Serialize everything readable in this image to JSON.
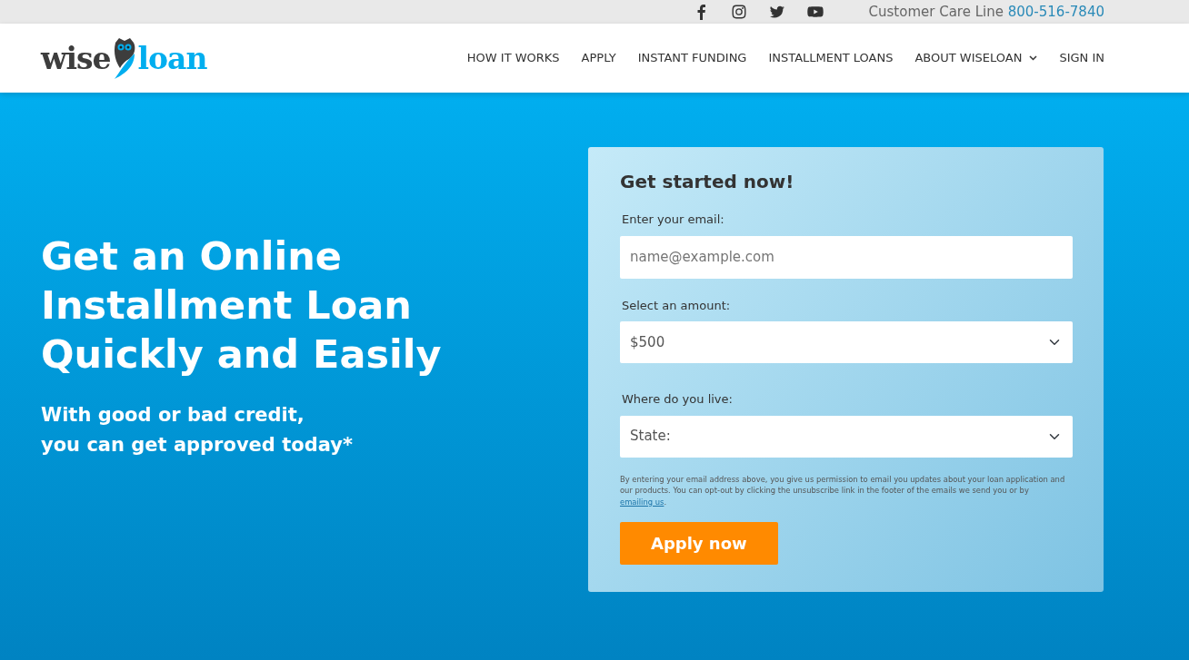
{
  "topbar": {
    "social": [
      {
        "kind": "facebook"
      },
      {
        "kind": "instagram"
      },
      {
        "kind": "twitter"
      },
      {
        "kind": "youtube"
      }
    ],
    "care_label": "Customer Care Line",
    "phone": "800-516-7840"
  },
  "logo": {
    "part_1": "wise",
    "part_2": "loan"
  },
  "nav": [
    {
      "label": "HOW IT WORKS",
      "dropdown": false
    },
    {
      "label": "APPLY",
      "dropdown": false
    },
    {
      "label": "INSTANT FUNDING",
      "dropdown": false
    },
    {
      "label": "INSTALLMENT LOANS",
      "dropdown": false
    },
    {
      "label": "ABOUT WISELOAN",
      "dropdown": true
    },
    {
      "label": "SIGN IN",
      "dropdown": false
    }
  ],
  "hero": {
    "headline": [
      "Get an Online",
      "Installment Loan",
      "Quickly and Easily"
    ],
    "subline": [
      "With good or bad credit,",
      "you can get approved today*"
    ]
  },
  "form": {
    "title": "Get started now!",
    "fields": [
      {
        "kind": "input",
        "label": "Enter your email:",
        "placeholder": "name@example.com"
      },
      {
        "kind": "select",
        "label": "Select an amount:",
        "value": "$500"
      },
      {
        "kind": "select",
        "label": "Where do you live:",
        "value": "State:"
      }
    ],
    "disclaimer": {
      "before": "By entering your email address above, you give us permission to email you updates about your loan application and our products. You can opt-out by clicking the unsubscribe link in the footer of the emails we send you or by ",
      "link": "emailing us",
      "after": "."
    },
    "button": "Apply now"
  }
}
